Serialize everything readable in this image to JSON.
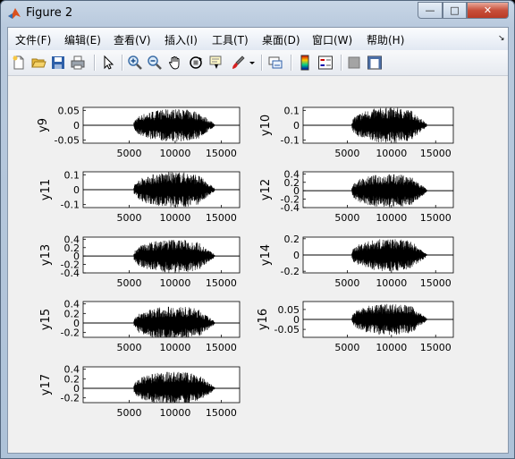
{
  "window": {
    "title": "Figure 2",
    "minimize": "—",
    "maximize": "□",
    "close": "✕"
  },
  "menus": [
    "文件(F)",
    "编辑(E)",
    "查看(V)",
    "插入(I)",
    "工具(T)",
    "桌面(D)",
    "窗口(W)",
    "帮助(H)"
  ],
  "menu_dock_glyph": "↘",
  "toolbar_icons": [
    "new-figure-icon",
    "open-file-icon",
    "save-icon",
    "print-icon",
    "edit-plot-arrow-icon",
    "zoom-in-icon",
    "zoom-out-icon",
    "pan-hand-icon",
    "rotate-3d-icon",
    "data-cursor-icon",
    "brush-icon",
    "brush-dropdown-icon",
    "link-plot-icon",
    "colorbar-icon",
    "legend-icon",
    "hide-plot-tools-icon",
    "show-plot-tools-icon"
  ],
  "chart_data": [
    {
      "type": "line",
      "ylabel": "y9",
      "xlim": [
        0,
        17000
      ],
      "ylim": [
        -0.06,
        0.06
      ],
      "yticks": [
        "0.05",
        "0",
        "-0.05"
      ],
      "yticks_val": [
        0.05,
        0,
        -0.05
      ],
      "xticks": [
        "5000",
        "10000",
        "15000"
      ],
      "signal_range": [
        5500,
        14300
      ],
      "amplitude": 0.055
    },
    {
      "type": "line",
      "ylabel": "y10",
      "xlim": [
        0,
        17000
      ],
      "ylim": [
        -0.12,
        0.12
      ],
      "yticks": [
        "0.1",
        "0",
        "-0.1"
      ],
      "yticks_val": [
        0.1,
        0,
        -0.1
      ],
      "xticks": [
        "5000",
        "10000",
        "15000"
      ],
      "signal_range": [
        5500,
        14000
      ],
      "amplitude": 0.12
    },
    {
      "type": "line",
      "ylabel": "y11",
      "xlim": [
        0,
        17000
      ],
      "ylim": [
        -0.12,
        0.12
      ],
      "yticks": [
        "0.1",
        "0",
        "-0.1"
      ],
      "yticks_val": [
        0.1,
        0,
        -0.1
      ],
      "xticks": [
        "5000",
        "10000",
        "15000"
      ],
      "signal_range": [
        5500,
        14300
      ],
      "amplitude": 0.12
    },
    {
      "type": "line",
      "ylabel": "y12",
      "xlim": [
        0,
        17000
      ],
      "ylim": [
        -0.4,
        0.45
      ],
      "yticks": [
        "0.4",
        "0.2",
        "0",
        "-0.2",
        "-0.4"
      ],
      "yticks_val": [
        0.4,
        0.2,
        0,
        -0.2,
        -0.4
      ],
      "xticks": [
        "5000",
        "10000",
        "15000"
      ],
      "signal_range": [
        5500,
        14000
      ],
      "amplitude": 0.4
    },
    {
      "type": "line",
      "ylabel": "y13",
      "xlim": [
        0,
        17000
      ],
      "ylim": [
        -0.4,
        0.45
      ],
      "yticks": [
        "0.4",
        "0.2",
        "0",
        "-0.2",
        "-0.4"
      ],
      "yticks_val": [
        0.4,
        0.2,
        0,
        -0.2,
        -0.4
      ],
      "xticks": [
        "5000",
        "10000",
        "15000"
      ],
      "signal_range": [
        5500,
        14300
      ],
      "amplitude": 0.4
    },
    {
      "type": "line",
      "ylabel": "y14",
      "xlim": [
        0,
        17000
      ],
      "ylim": [
        -0.22,
        0.22
      ],
      "yticks": [
        "0.2",
        "0",
        "-0.2"
      ],
      "yticks_val": [
        0.2,
        0,
        -0.2
      ],
      "xticks": [
        "5000",
        "10000",
        "15000"
      ],
      "signal_range": [
        5500,
        14000
      ],
      "amplitude": 0.2
    },
    {
      "type": "line",
      "ylabel": "y15",
      "xlim": [
        0,
        17000
      ],
      "ylim": [
        -0.3,
        0.45
      ],
      "yticks": [
        "0.4",
        "0.2",
        "0",
        "-0.2"
      ],
      "yticks_val": [
        0.4,
        0.2,
        0,
        -0.2
      ],
      "xticks": [
        "5000",
        "10000",
        "15000"
      ],
      "signal_range": [
        5500,
        14300
      ],
      "amplitude": 0.35
    },
    {
      "type": "line",
      "ylabel": "y16",
      "xlim": [
        0,
        17000
      ],
      "ylim": [
        -0.09,
        0.09
      ],
      "yticks": [
        "0.05",
        "0",
        "-0.05"
      ],
      "yticks_val": [
        0.05,
        0,
        -0.05
      ],
      "xticks": [
        "5000",
        "10000",
        "15000"
      ],
      "signal_range": [
        5500,
        14000
      ],
      "amplitude": 0.08
    },
    {
      "type": "line",
      "ylabel": "y17",
      "xlim": [
        0,
        17000
      ],
      "ylim": [
        -0.3,
        0.45
      ],
      "yticks": [
        "0.4",
        "0.2",
        "0",
        "-0.2"
      ],
      "yticks_val": [
        0.4,
        0.2,
        0,
        -0.2
      ],
      "xticks": [
        "5000",
        "10000",
        "15000"
      ],
      "signal_range": [
        5500,
        14300
      ],
      "amplitude": 0.35
    }
  ]
}
